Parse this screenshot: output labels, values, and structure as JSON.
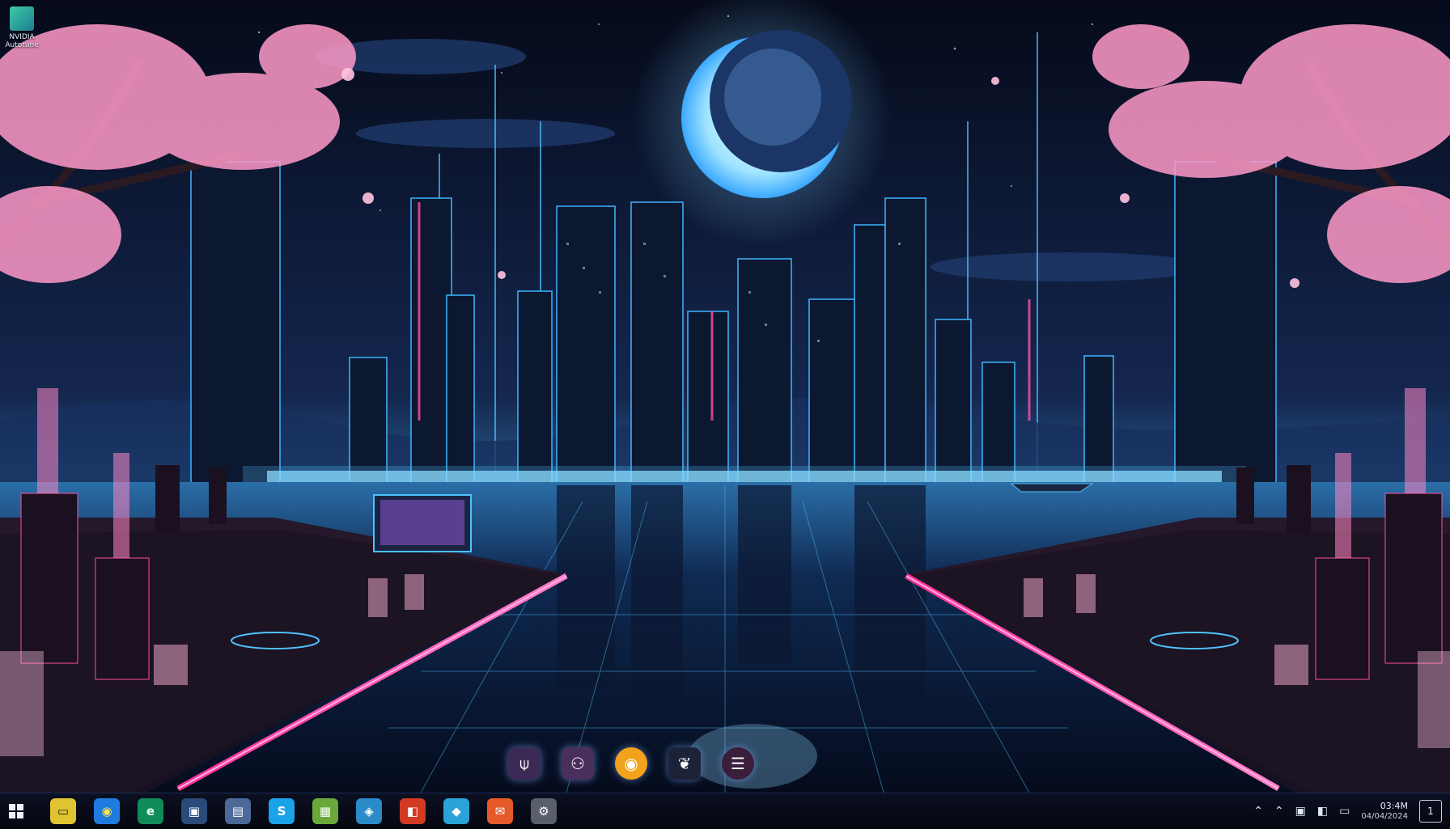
{
  "desktop": {
    "icon": {
      "label": "NVIDIA Autotune",
      "icon": "app-shortcut-icon"
    }
  },
  "dock": {
    "items": [
      {
        "name": "app-one-icon",
        "glyph": "⍦",
        "bg": "#3b2a55"
      },
      {
        "name": "app-two-icon",
        "glyph": "⚇",
        "bg": "#4a2e5c"
      },
      {
        "name": "chrome-icon",
        "glyph": "◉",
        "bg": "#f2a21b"
      },
      {
        "name": "app-four-icon",
        "glyph": "❦",
        "bg": "#1c2238"
      },
      {
        "name": "menu-icon",
        "glyph": "☰",
        "bg": "#3a1e3c"
      }
    ]
  },
  "taskbar": {
    "start_icon": "windows-start-icon",
    "apps": [
      {
        "name": "files-icon",
        "glyph": "▭",
        "bg": "#e0c331",
        "fg": "#222"
      },
      {
        "name": "chrome-icon",
        "glyph": "◉",
        "bg": "#1f7be0",
        "fg": "#fce44d"
      },
      {
        "name": "edge-icon",
        "glyph": "e",
        "bg": "#0f8c5a",
        "fg": "#e6ffe6"
      },
      {
        "name": "photos-icon",
        "glyph": "▣",
        "bg": "#2a4a7a",
        "fg": "#fff"
      },
      {
        "name": "ms-store-icon",
        "glyph": "▤",
        "bg": "#4b6a9a",
        "fg": "#fff"
      },
      {
        "name": "skype-icon",
        "glyph": "S",
        "bg": "#1aa3e8",
        "fg": "#fff"
      },
      {
        "name": "notes-icon",
        "glyph": "▦",
        "bg": "#6aa83a",
        "fg": "#fff"
      },
      {
        "name": "app-blue-icon",
        "glyph": "◈",
        "bg": "#2b8ac8",
        "fg": "#fff"
      },
      {
        "name": "office-icon",
        "glyph": "◧",
        "bg": "#d23a22",
        "fg": "#fff"
      },
      {
        "name": "cube-icon",
        "glyph": "◆",
        "bg": "#2aa3d8",
        "fg": "#fff"
      },
      {
        "name": "mail-icon",
        "glyph": "✉",
        "bg": "#e65a2a",
        "fg": "#fff"
      },
      {
        "name": "settings-icon",
        "glyph": "⚙",
        "bg": "#5a5f6c",
        "fg": "#fff"
      }
    ],
    "tray": {
      "icons": [
        "chevron-up-icon",
        "chevron-up-icon",
        "network-icon",
        "volume-icon",
        "battery-icon"
      ],
      "clock_time": "03:4M",
      "clock_date": "04/04/2024",
      "notification_label": "1"
    }
  },
  "colors": {
    "accent_blue": "#4fc3ff",
    "accent_pink": "#ff4fa3",
    "sky": "#0a1634"
  }
}
